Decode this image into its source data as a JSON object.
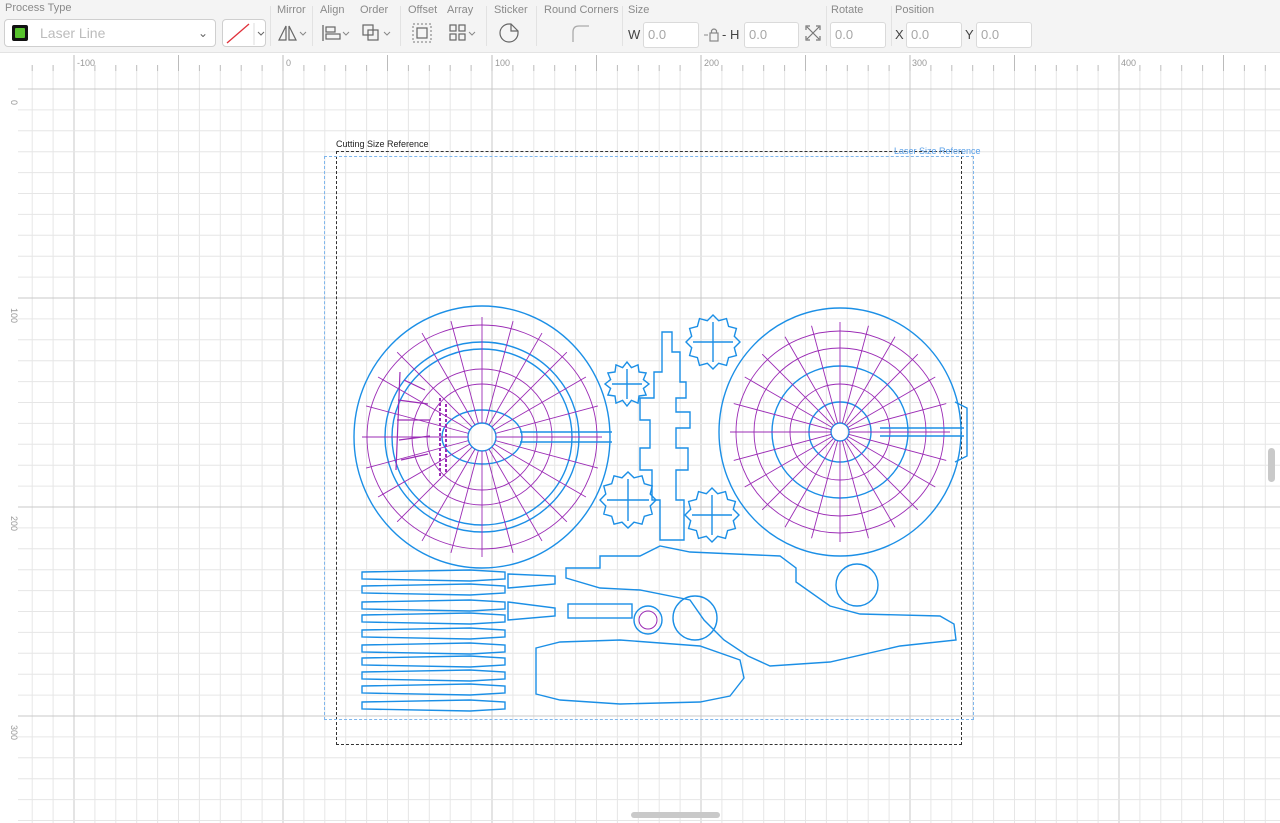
{
  "toolbar": {
    "process_type_label": "Process Type",
    "process_type_value": "Laser Line",
    "mirror_label": "Mirror",
    "align_label": "Align",
    "order_label": "Order",
    "offset_label": "Offset",
    "array_label": "Array",
    "sticker_label": "Sticker",
    "round_corners_label": "Round Corners",
    "size_label": "Size",
    "w_label": "W",
    "w_value": "0.0",
    "h_label": "- H",
    "h_value": "0.0",
    "rotate_label": "Rotate",
    "rotate_value": "0.0",
    "position_label": "Position",
    "x_label": "X",
    "x_value": "0.0",
    "y_label": "Y",
    "y_value": "0.0"
  },
  "ruler": {
    "h_ticks": [
      "-100",
      "0",
      "100",
      "200",
      "300",
      "400"
    ],
    "v_ticks": [
      "0",
      "100",
      "200",
      "300"
    ]
  },
  "canvas": {
    "cutting_ref_label": "Cutting Size Reference",
    "laser_ref_label": "Laser Size Reference"
  },
  "colors": {
    "cut_line": "#1b8fe6",
    "engrave_line": "#9b2bb5",
    "laser_ref": "#5aa0e8",
    "accent_green": "#57c22d"
  }
}
